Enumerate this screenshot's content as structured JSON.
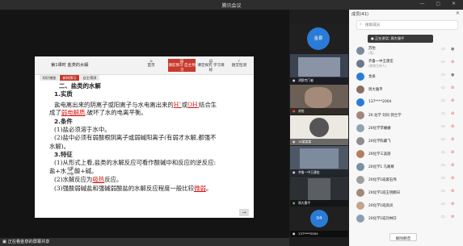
{
  "window": {
    "title": "腾讯会议"
  },
  "share_status": "正在看金泉的屏幕共享",
  "doc": {
    "lesson": "第1课时    盐类的水解",
    "nav_tabs": [
      {
        "label": "首页",
        "icon": "home-icon"
      },
      {
        "label": "课前预习 自主预习",
        "icon": "book-icon"
      },
      {
        "label": "课堂探究 学习目标",
        "icon": "book-icon"
      },
      {
        "label": "随堂检测",
        "icon": "check-icon"
      }
    ],
    "sub_tabs": [
      "知识铺垫",
      "新知预习",
      "自主预测"
    ],
    "content": {
      "heading": "二、盐类的水解",
      "s1_title": "1.实质",
      "s1_line1_a": "盐电离出来的阴离子或阳离子与水电离出来的",
      "s1_hplus": "H",
      "s1_plus_sup": "+",
      "s1_or": "或",
      "s1_oh": "OH",
      "s1_minus_sup": "-",
      "s1_line1_b": "结合生",
      "s1_line2_a": "成了",
      "s1_weak": "弱电解质",
      "s1_line2_b": ",破坏了水的电离平衡。",
      "s2_title": "2.条件",
      "s2_l1": "(1)盐必须溶于水中。",
      "s2_l2": "(2)盐中必须有弱酸根阴离子或弱碱阳离子(有弱才水解,都强不",
      "s2_l3": "水解)。",
      "s3_title": "3.特征",
      "s3_l1": "(1)从形式上看,盐类的水解反应可看作酸碱中和反应的逆反应:",
      "s3_l2_a": "盐+水",
      "s3_frac_top": "水解",
      "s3_frac_bot": "中和",
      "s3_l2_b": "酸+碱。",
      "s3_l3_a": "(2)水解反应为",
      "s3_endo": "吸热",
      "s3_l3_b": "反应。",
      "s3_l4_a": "(3)强酸弱碱盐和强碱弱酸盐的水解反应程度一般比较",
      "s3_weak": "微弱",
      "s3_l4_b": "。"
    }
  },
  "video_tiles": [
    {
      "type": "avatar",
      "initials": "金泉",
      "color": "#2a7bd6"
    },
    {
      "type": "video",
      "label": "鸿鹄专门者",
      "icon": "mic-icon"
    },
    {
      "type": "video",
      "label": "苏怡",
      "icon": "mic-icon"
    },
    {
      "type": "video",
      "label": "18某某某",
      "icon": "mic-icon"
    },
    {
      "type": "video",
      "label": "齐鲁一中王建宏",
      "icon": "mic-icon"
    },
    {
      "type": "video",
      "label": "周大雅平",
      "icon": "mic-icon"
    },
    {
      "type": "avatar",
      "initials": "04",
      "color": "#2a7bd6",
      "label": "137****2004"
    }
  ],
  "panel": {
    "title": "成员(41)",
    "search_placeholder": "搜索成员",
    "tooltip": "正在讲话: 周大雅平",
    "members": [
      {
        "name": "苏怡",
        "sub": "(我)",
        "color": "#7a8c9c",
        "muted": false
      },
      {
        "name": "齐鲁一中王建宏",
        "sub": "(联席主持人)",
        "color": "#6a7a8a",
        "muted": true
      },
      {
        "name": "金泉",
        "sub": "",
        "color": "#2a7bd6",
        "muted": false
      },
      {
        "name": "周大雅平",
        "sub": "",
        "color": "#8d6e63",
        "muted": true
      },
      {
        "name": "137****2004",
        "sub": "",
        "color": "#2a7bd6",
        "muted": true
      },
      {
        "name": "20.化学 刘同 郭兰学",
        "sub": "",
        "color": "#a1887f",
        "muted": true
      },
      {
        "name": "20化学李姗姗",
        "sub": "",
        "color": "#90a4ae",
        "muted": true
      },
      {
        "name": "20化学陈藏飞",
        "sub": "",
        "color": "#8d8d8d",
        "muted": true
      },
      {
        "name": "20化学三美丽",
        "sub": "",
        "color": "#b08060",
        "muted": true
      },
      {
        "name": "20化学1 马路尊",
        "sub": "",
        "color": "#7b8fa0",
        "muted": true
      },
      {
        "name": "20化学1班袭石伟",
        "sub": "",
        "color": "#9e9e9e",
        "muted": true
      },
      {
        "name": "20化学1班王明鹏日",
        "sub": "",
        "color": "#a08a78",
        "muted": true
      },
      {
        "name": "20化学1班高凤",
        "sub": "",
        "color": "#c2a58b",
        "muted": true
      },
      {
        "name": "20化学1班刘林芬",
        "sub": "",
        "color": "#8aa0b2",
        "muted": true
      }
    ],
    "mute_all": "解除静音"
  }
}
